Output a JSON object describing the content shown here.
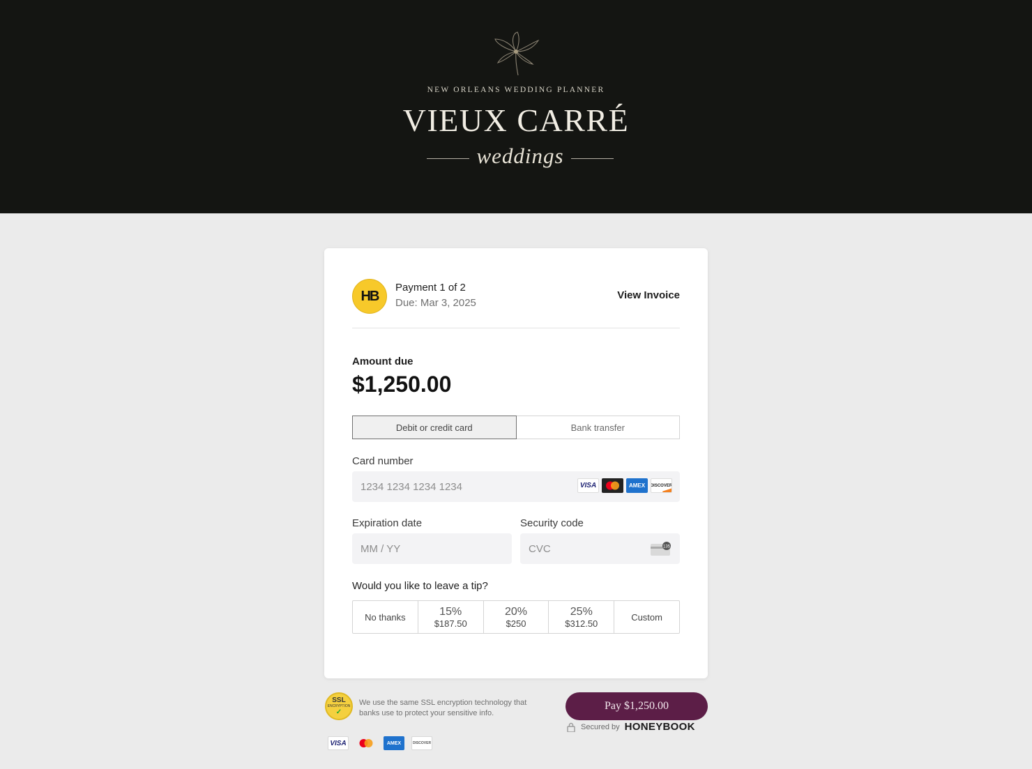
{
  "hero": {
    "tagline": "NEW ORLEANS WEDDING PLANNER",
    "brand": "VIEUX CARRÉ",
    "script": "weddings"
  },
  "payment": {
    "logo": "HB",
    "label": "Payment 1 of 2",
    "due": "Due: Mar 3, 2025",
    "view_invoice": "View Invoice",
    "amount_label": "Amount due",
    "amount": "$1,250.00"
  },
  "tabs": [
    "Debit or credit card",
    "Bank transfer"
  ],
  "card_form": {
    "number_label": "Card number",
    "number_placeholder": "1234 1234 1234 1234",
    "exp_label": "Expiration date",
    "exp_placeholder": "MM / YY",
    "cvc_label": "Security code",
    "cvc_placeholder": "CVC",
    "brands": [
      "VISA",
      "",
      "AMEX",
      "DISCOVER"
    ]
  },
  "tip": {
    "question": "Would you like to leave a tip?",
    "options": [
      {
        "label": "No thanks"
      },
      {
        "pct": "15%",
        "amount": "$187.50"
      },
      {
        "pct": "20%",
        "amount": "$250"
      },
      {
        "pct": "25%",
        "amount": "$312.50"
      },
      {
        "label": "Custom"
      }
    ]
  },
  "footer": {
    "ssl_badge_top": "SSL",
    "ssl_badge_bottom": "ENCRYPTION",
    "ssl_text": "We use the same SSL encryption technology that banks use to protect your sensitive info.",
    "pay_button": "Pay $1,250.00",
    "secured_by": "Secured by",
    "secured_brand": "HONEYBOOK",
    "brands": [
      "VISA",
      "",
      "AMEX",
      "DISCOVER"
    ]
  },
  "colors": {
    "hero_bg": "#141512",
    "pay_button": "#5c1e47",
    "hb_logo": "#f7c92a"
  }
}
